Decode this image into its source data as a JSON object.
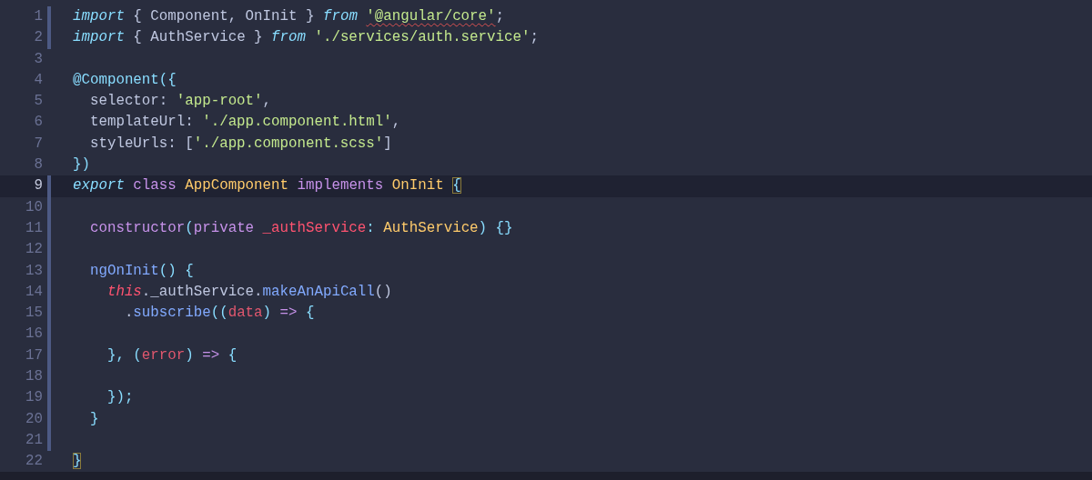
{
  "editor": {
    "lines": [
      {
        "number": "1",
        "active": false,
        "modified": true,
        "tokens": [
          {
            "text": "import",
            "kind": "keyword"
          },
          {
            "text": " { Component, OnInit } ",
            "kind": "plain"
          },
          {
            "text": "from ",
            "kind": "keyword"
          },
          {
            "text": "'@angular/core'",
            "kind": "string",
            "squiggle": true
          },
          {
            "text": ";",
            "kind": "plain"
          }
        ]
      },
      {
        "number": "2",
        "active": false,
        "modified": true,
        "tokens": [
          {
            "text": "import",
            "kind": "keyword"
          },
          {
            "text": " { AuthService } ",
            "kind": "plain"
          },
          {
            "text": "from ",
            "kind": "keyword"
          },
          {
            "text": "'./services/auth.service'",
            "kind": "string"
          },
          {
            "text": ";",
            "kind": "plain"
          }
        ]
      },
      {
        "number": "3",
        "active": false,
        "modified": false
      },
      {
        "number": "4",
        "active": false,
        "modified": false,
        "tokens": [
          {
            "text": "@Component",
            "kind": "punct"
          },
          {
            "text": "({",
            "kind": "punct"
          }
        ]
      },
      {
        "number": "5",
        "active": false,
        "modified": false,
        "tokens": [
          {
            "text": "  selector: ",
            "kind": "plain"
          },
          {
            "text": "'app-root'",
            "kind": "string"
          },
          {
            "text": ",",
            "kind": "plain"
          }
        ]
      },
      {
        "number": "6",
        "active": false,
        "modified": false,
        "tokens": [
          {
            "text": "  templateUrl: ",
            "kind": "plain"
          },
          {
            "text": "'./app.component.html'",
            "kind": "string"
          },
          {
            "text": ",",
            "kind": "plain"
          }
        ]
      },
      {
        "number": "7",
        "active": false,
        "modified": false,
        "tokens": [
          {
            "text": "  styleUrls: [",
            "kind": "plain"
          },
          {
            "text": "'./app.component.scss'",
            "kind": "string"
          },
          {
            "text": "]",
            "kind": "plain"
          }
        ]
      },
      {
        "number": "8",
        "active": false,
        "modified": false,
        "tokens": [
          {
            "text": "})",
            "kind": "punct"
          }
        ]
      },
      {
        "number": "9",
        "active": true,
        "modified": true,
        "tokens": [
          {
            "text": "export ",
            "kind": "keyword"
          },
          {
            "text": "class ",
            "kind": "storage"
          },
          {
            "text": "AppComponent ",
            "kind": "type"
          },
          {
            "text": "implements ",
            "kind": "storage"
          },
          {
            "text": "OnInit ",
            "kind": "type"
          },
          {
            "text": "{",
            "kind": "bracket-match"
          }
        ]
      },
      {
        "number": "10",
        "active": false,
        "modified": true
      },
      {
        "number": "11",
        "active": false,
        "modified": true,
        "tokens": [
          {
            "text": "  constructor",
            "kind": "storage"
          },
          {
            "text": "(",
            "kind": "punct"
          },
          {
            "text": "private ",
            "kind": "storage"
          },
          {
            "text": "_authService",
            "kind": "variable"
          },
          {
            "text": ": ",
            "kind": "punct"
          },
          {
            "text": "AuthService",
            "kind": "type"
          },
          {
            "text": ") {}",
            "kind": "punct"
          }
        ]
      },
      {
        "number": "12",
        "active": false,
        "modified": true
      },
      {
        "number": "13",
        "active": false,
        "modified": true,
        "tokens": [
          {
            "text": "  ngOnInit",
            "kind": "function"
          },
          {
            "text": "() {",
            "kind": "punct"
          }
        ]
      },
      {
        "number": "14",
        "active": false,
        "modified": true,
        "tokens": [
          {
            "text": "    this",
            "kind": "this"
          },
          {
            "text": "._authService.",
            "kind": "plain"
          },
          {
            "text": "makeAnApiCall",
            "kind": "function"
          },
          {
            "text": "()",
            "kind": "plain"
          }
        ]
      },
      {
        "number": "15",
        "active": false,
        "modified": true,
        "tokens": [
          {
            "text": "      .",
            "kind": "plain"
          },
          {
            "text": "subscribe",
            "kind": "function"
          },
          {
            "text": "((",
            "kind": "punct"
          },
          {
            "text": "data",
            "kind": "param"
          },
          {
            "text": ") ",
            "kind": "punct"
          },
          {
            "text": "=>",
            "kind": "storage"
          },
          {
            "text": " {",
            "kind": "punct"
          }
        ]
      },
      {
        "number": "16",
        "active": false,
        "modified": true
      },
      {
        "number": "17",
        "active": false,
        "modified": true,
        "tokens": [
          {
            "text": "    }, (",
            "kind": "punct"
          },
          {
            "text": "error",
            "kind": "param"
          },
          {
            "text": ") ",
            "kind": "punct"
          },
          {
            "text": "=>",
            "kind": "storage"
          },
          {
            "text": " {",
            "kind": "punct"
          }
        ]
      },
      {
        "number": "18",
        "active": false,
        "modified": true
      },
      {
        "number": "19",
        "active": false,
        "modified": true,
        "tokens": [
          {
            "text": "    });",
            "kind": "punct"
          }
        ]
      },
      {
        "number": "20",
        "active": false,
        "modified": true,
        "tokens": [
          {
            "text": "  }",
            "kind": "punct"
          }
        ]
      },
      {
        "number": "21",
        "active": false,
        "modified": true
      },
      {
        "number": "22",
        "active": false,
        "modified": false,
        "tokens": [
          {
            "text": "}",
            "kind": "bracket-match"
          }
        ]
      }
    ]
  }
}
